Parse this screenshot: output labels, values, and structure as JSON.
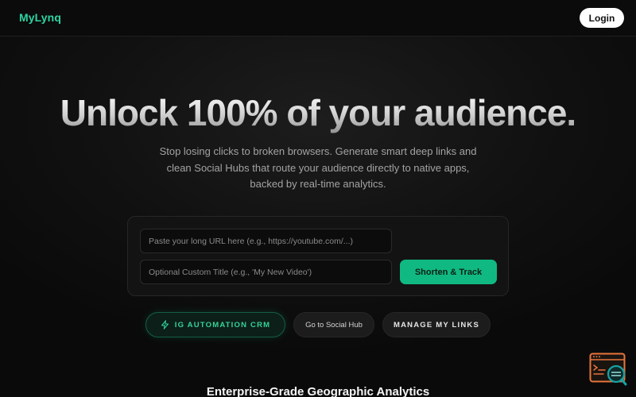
{
  "header": {
    "logo_text": "MyLynq",
    "login_label": "Login"
  },
  "hero": {
    "title": "Unlock 100% of your audience.",
    "subtitle": "Stop losing clicks to broken browsers. Generate smart deep links and clean Social Hubs that route your audience directly to native apps, backed by real-time analytics."
  },
  "form": {
    "url_placeholder": "Paste your long URL here (e.g., https://youtube.com/...)",
    "url_value": "",
    "title_placeholder": "Optional Custom Title (e.g., 'My New Video')",
    "title_value": "",
    "submit_label": "Shorten & Track"
  },
  "actions": {
    "ig_automation_label": "IG AUTOMATION CRM",
    "ig_icon": "bolt-icon",
    "social_hub_label": "Go to Social Hub",
    "manage_links_label": "MANAGE MY LINKS"
  },
  "section": {
    "title": "Enterprise-Grade Geographic Analytics"
  },
  "floating_widget": {
    "icon": "chat-search-icon"
  },
  "colors": {
    "brand_accent": "#2dd4a3",
    "primary_button": "#10b981",
    "background": "#0a0a0a",
    "widget_orange": "#e8743c",
    "widget_teal": "#16a3a3"
  }
}
